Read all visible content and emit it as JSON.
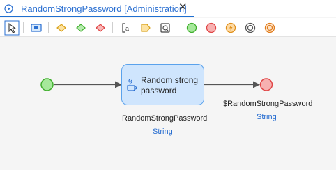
{
  "tab": {
    "title": "RandomStrongPassword [Administration]",
    "close_label": "✕"
  },
  "toolbar": {
    "items": [
      "pointer-tool",
      "parameter",
      "decision",
      "object-type-decision",
      "merge",
      "annotation",
      "loop-label",
      "start-event",
      "end-event",
      "error-event",
      "break-event",
      "continue-event"
    ]
  },
  "activity": {
    "label": "Random strong password",
    "output_name": "RandomStrongPassword",
    "output_type": "String"
  },
  "end_event": {
    "return_value": "$RandomStrongPassword",
    "return_type": "String"
  },
  "colors": {
    "accent": "#1e6fd1",
    "activity_fill": "#cfe5fd",
    "activity_border": "#5aa2ec",
    "start_fill": "#a6e89b",
    "start_stroke": "#3fae2c",
    "end_fill": "#f7b0b0",
    "end_stroke": "#e04545"
  }
}
